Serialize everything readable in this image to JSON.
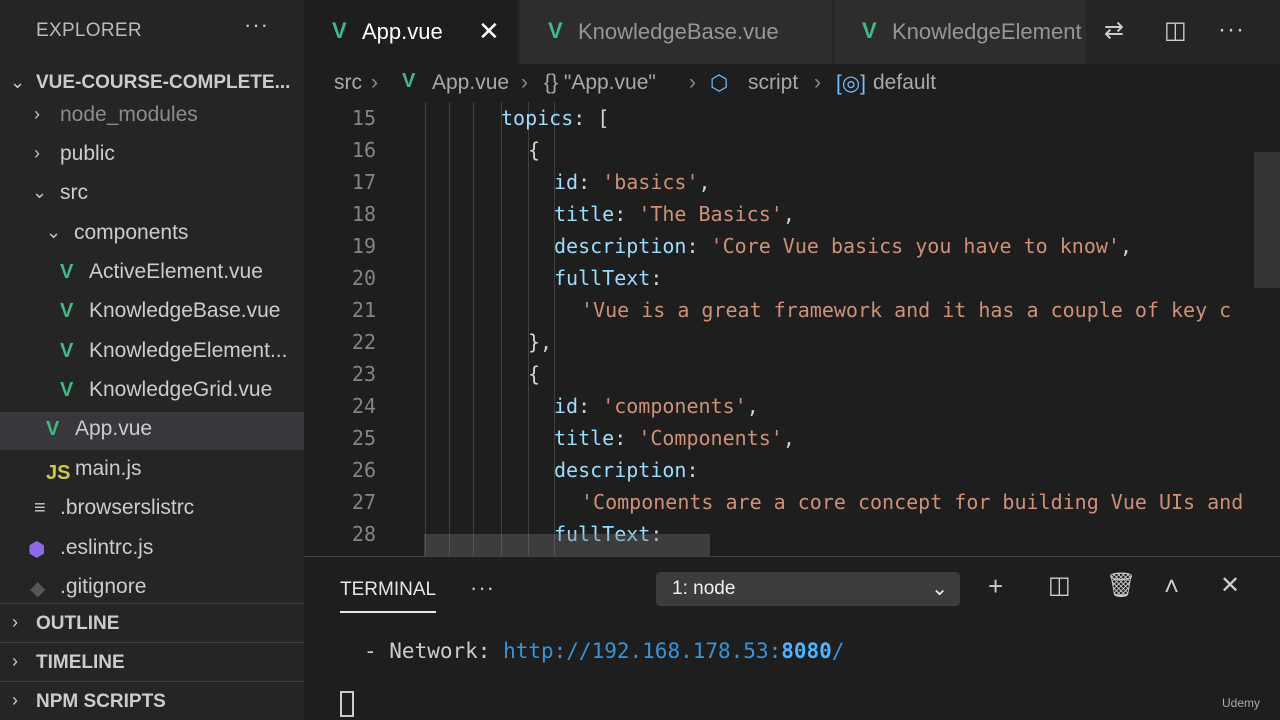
{
  "explorer": {
    "title": "EXPLORER",
    "more": "···",
    "project": "VUE-COURSE-COMPLETE...",
    "tree": [
      {
        "label": "node_modules",
        "type": "folder",
        "expanded": false
      },
      {
        "label": "public",
        "type": "folder",
        "expanded": false
      },
      {
        "label": "src",
        "type": "folder",
        "expanded": true
      },
      {
        "label": "components",
        "type": "folder",
        "expanded": true
      },
      {
        "label": "ActiveElement.vue",
        "type": "vue"
      },
      {
        "label": "KnowledgeBase.vue",
        "type": "vue"
      },
      {
        "label": "KnowledgeElement...",
        "type": "vue"
      },
      {
        "label": "KnowledgeGrid.vue",
        "type": "vue"
      },
      {
        "label": "App.vue",
        "type": "vue",
        "selected": true
      },
      {
        "label": "main.js",
        "type": "js",
        "icon": "JS"
      },
      {
        "label": ".browserslistrc",
        "type": "lines"
      },
      {
        "label": ".eslintrc.js",
        "type": "eslint"
      },
      {
        "label": ".gitignore",
        "type": "git"
      }
    ],
    "sections": [
      "OUTLINE",
      "TIMELINE",
      "NPM SCRIPTS"
    ]
  },
  "tabs": [
    {
      "label": "App.vue",
      "active": true
    },
    {
      "label": "KnowledgeBase.vue",
      "active": false
    },
    {
      "label": "KnowledgeElement",
      "active": false
    }
  ],
  "breadcrumb": {
    "folder": "src",
    "file": "App.vue",
    "object": "{} \"App.vue\"",
    "script": "script",
    "default": "default"
  },
  "editor": {
    "lines": [
      {
        "n": "15",
        "key": "topics",
        "rest": ": ["
      },
      {
        "n": "16",
        "punct": "{"
      },
      {
        "n": "17",
        "key": "id",
        "sep": ": ",
        "str": "'basics'",
        "tail": ","
      },
      {
        "n": "18",
        "key": "title",
        "sep": ": ",
        "str": "'The Basics'",
        "tail": ","
      },
      {
        "n": "19",
        "key": "description",
        "sep": ": ",
        "str": "'Core Vue basics you have to know'",
        "tail": ","
      },
      {
        "n": "20",
        "key": "fullText",
        "sep": ":"
      },
      {
        "n": "21",
        "str": "'Vue is a great framework and it has a couple of key c"
      },
      {
        "n": "22",
        "punct": "},"
      },
      {
        "n": "23",
        "punct": "{"
      },
      {
        "n": "24",
        "key": "id",
        "sep": ": ",
        "str": "'components'",
        "tail": ","
      },
      {
        "n": "25",
        "key": "title",
        "sep": ": ",
        "str": "'Components'",
        "tail": ","
      },
      {
        "n": "26",
        "key": "description",
        "sep": ":"
      },
      {
        "n": "27",
        "str": "'Components are a core concept for building Vue UIs and"
      },
      {
        "n": "28",
        "key": "fullText",
        "sep": ":"
      }
    ]
  },
  "panel": {
    "tab": "TERMINAL",
    "more": "···",
    "terminal_select": "1: node",
    "output_prefix": "- Network: ",
    "url_main": "http://192.168.178.53:",
    "url_port": "8080",
    "url_tail": "/"
  },
  "watermark": "Udemy"
}
